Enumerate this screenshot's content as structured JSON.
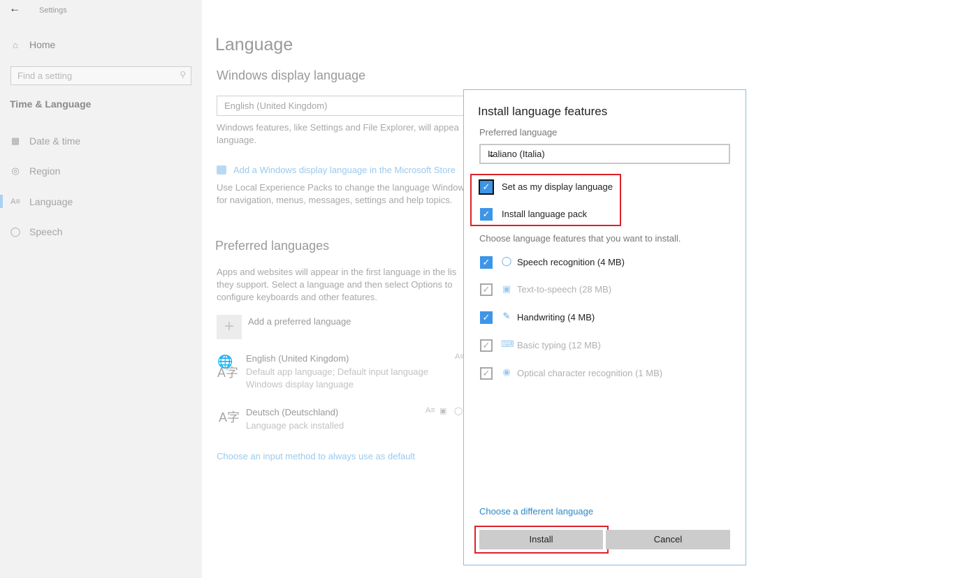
{
  "window": {
    "title": "Settings"
  },
  "sidebar": {
    "home_label": "Home",
    "search_placeholder": "Find a setting",
    "section_title": "Time & Language",
    "items": [
      {
        "label": "Date & time",
        "icon": "calendar-clock-icon"
      },
      {
        "label": "Region",
        "icon": "globe-icon"
      },
      {
        "label": "Language",
        "icon": "language-icon",
        "active": true
      },
      {
        "label": "Speech",
        "icon": "microphone-icon"
      }
    ]
  },
  "main": {
    "title": "Language",
    "display_language": {
      "heading": "Windows display language",
      "selected": "English (United Kingdom)",
      "description_line1": "Windows features, like Settings and File Explorer, will appea",
      "description_line2": "language.",
      "store_link": "Add a Windows display language in the Microsoft Store",
      "lxp_line1": "Use Local Experience Packs to change the language Window",
      "lxp_line2": "for navigation, menus, messages, settings and help topics."
    },
    "preferred": {
      "heading": "Preferred languages",
      "desc_line1": "Apps and websites will appear in the first language in the lis",
      "desc_line2": "they support. Select a language and then select Options to",
      "desc_line3": "configure keyboards and other features.",
      "add_label": "Add a preferred language",
      "languages": [
        {
          "name": "English (United Kingdom)",
          "sub1": "Default app language; Default input language",
          "sub2": "Windows display language"
        },
        {
          "name": "Deutsch (Deutschland)",
          "sub1": "Language pack installed"
        }
      ],
      "input_method_link": "Choose an input method to always use as default"
    }
  },
  "dialog": {
    "title": "Install language features",
    "preferred_label": "Preferred language",
    "preferred_value": "Italiano (Italia)",
    "options": [
      {
        "label": "Set as my display language",
        "checked": true
      },
      {
        "label": "Install language pack",
        "checked": true
      }
    ],
    "features_hint": "Choose language features that you want to install.",
    "features": [
      {
        "label": "Speech recognition (4 MB)",
        "checked": true,
        "enabled": true,
        "icon": "microphone-icon"
      },
      {
        "label": "Text-to-speech (28 MB)",
        "checked": true,
        "enabled": false,
        "icon": "speech-bubble-icon"
      },
      {
        "label": "Handwriting (4 MB)",
        "checked": true,
        "enabled": true,
        "icon": "pen-icon"
      },
      {
        "label": "Basic typing (12 MB)",
        "checked": true,
        "enabled": false,
        "icon": "keyboard-icon"
      },
      {
        "label": "Optical character recognition (1 MB)",
        "checked": true,
        "enabled": false,
        "icon": "ocr-camera-icon"
      }
    ],
    "different_language_link": "Choose a different language",
    "install_label": "Install",
    "cancel_label": "Cancel"
  }
}
